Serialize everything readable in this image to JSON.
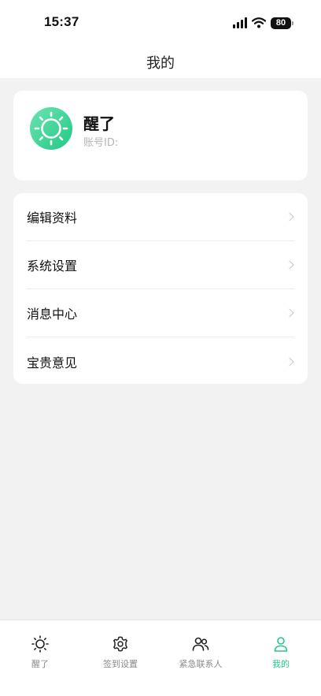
{
  "status_bar": {
    "time": "15:37",
    "battery": "80"
  },
  "header": {
    "title": "我的"
  },
  "profile": {
    "name": "醒了",
    "account_id_label": "账号ID:",
    "account_id_value": ""
  },
  "menu": {
    "items": [
      {
        "label": "编辑资料",
        "icon": "chevron-right-icon"
      },
      {
        "label": "系统设置",
        "icon": "chevron-right-icon"
      },
      {
        "label": "消息中心",
        "icon": "chevron-right-icon"
      },
      {
        "label": "宝贵意见",
        "icon": "chevron-right-icon"
      }
    ]
  },
  "tabbar": {
    "active_index": 3,
    "items": [
      {
        "label": "醒了",
        "icon": "sun-icon"
      },
      {
        "label": "签到设置",
        "icon": "gear-icon"
      },
      {
        "label": "紧急联系人",
        "icon": "contacts-icon"
      },
      {
        "label": "我的",
        "icon": "person-icon"
      }
    ]
  },
  "colors": {
    "accent": "#23c98a",
    "background": "#f2f2f2",
    "card": "#ffffff",
    "muted_text": "#b4b4b4"
  }
}
